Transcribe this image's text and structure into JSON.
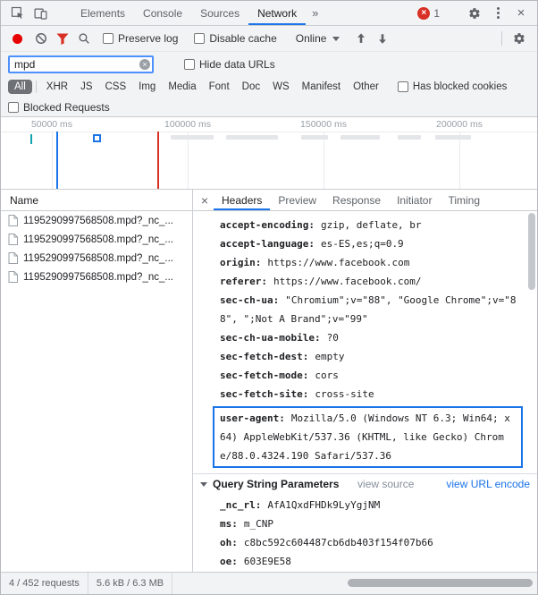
{
  "window": {
    "tabs": [
      "Elements",
      "Console",
      "Sources",
      "Network"
    ],
    "overflow_chevron": "»",
    "error_count": "1"
  },
  "icons": {
    "error_x": "×",
    "close": "×",
    "panel_close": "×",
    "input_clear": "×"
  },
  "toolbar": {
    "preserve_log_label": "Preserve log",
    "disable_cache_label": "Disable cache",
    "throttling_label": "Online"
  },
  "filter": {
    "value": "mpd",
    "hide_data_urls_label": "Hide data URLs",
    "type_filters": [
      "All",
      "XHR",
      "JS",
      "CSS",
      "Img",
      "Media",
      "Font",
      "Doc",
      "WS",
      "Manifest",
      "Other"
    ],
    "selected_type": "All",
    "has_blocked_cookies_label": "Has blocked cookies",
    "blocked_requests_label": "Blocked Requests"
  },
  "overview": {
    "ticks": [
      "50000 ms",
      "100000 ms",
      "150000 ms",
      "200000 ms"
    ]
  },
  "requests": {
    "name_header": "Name",
    "rows": [
      {
        "name": "1195290997568508.mpd?_nc_..."
      },
      {
        "name": "1195290997568508.mpd?_nc_..."
      },
      {
        "name": "1195290997568508.mpd?_nc_..."
      },
      {
        "name": "1195290997568508.mpd?_nc_..."
      }
    ]
  },
  "details": {
    "tabs": [
      "Headers",
      "Preview",
      "Response",
      "Initiator",
      "Timing"
    ],
    "active_tab": "Headers",
    "request_headers": [
      {
        "name": "accept-encoding",
        "value": "gzip, deflate, br"
      },
      {
        "name": "accept-language",
        "value": "es-ES,es;q=0.9"
      },
      {
        "name": "origin",
        "value": "https://www.facebook.com"
      },
      {
        "name": "referer",
        "value": "https://www.facebook.com/"
      },
      {
        "name": "sec-ch-ua",
        "value": "\"Chromium\";v=\"88\", \"Google Chrome\";v=\"88\", \";Not A Brand\";v=\"99\""
      },
      {
        "name": "sec-ch-ua-mobile",
        "value": "?0"
      },
      {
        "name": "sec-fetch-dest",
        "value": "empty"
      },
      {
        "name": "sec-fetch-mode",
        "value": "cors"
      },
      {
        "name": "sec-fetch-site",
        "value": "cross-site"
      },
      {
        "name": "user-agent",
        "value": "Mozilla/5.0 (Windows NT 6.3; Win64; x64) AppleWebKit/537.36 (KHTML, like Gecko) Chrome/88.0.4324.190 Safari/537.36",
        "highlighted": true
      }
    ],
    "query_string": {
      "title": "Query String Parameters",
      "view_source_label": "view source",
      "view_url_encoded_label": "view URL encode",
      "params": [
        {
          "name": "_nc_rl",
          "value": "AfA1QxdFHDk9LyYgjNM"
        },
        {
          "name": "ms",
          "value": "m_CNP"
        },
        {
          "name": "oh",
          "value": "c8bc592c604487cb6db403f154f07b66"
        },
        {
          "name": "oe",
          "value": "603E9E58"
        }
      ]
    }
  },
  "status_bar": {
    "requests": "4 / 452 requests",
    "transferred": "5.6 kB / 6.3 MB"
  },
  "colors": {
    "accent": "#1a73e8",
    "error": "#d93025",
    "record_red": "#e60000",
    "focus_border": "#4d90fe"
  }
}
